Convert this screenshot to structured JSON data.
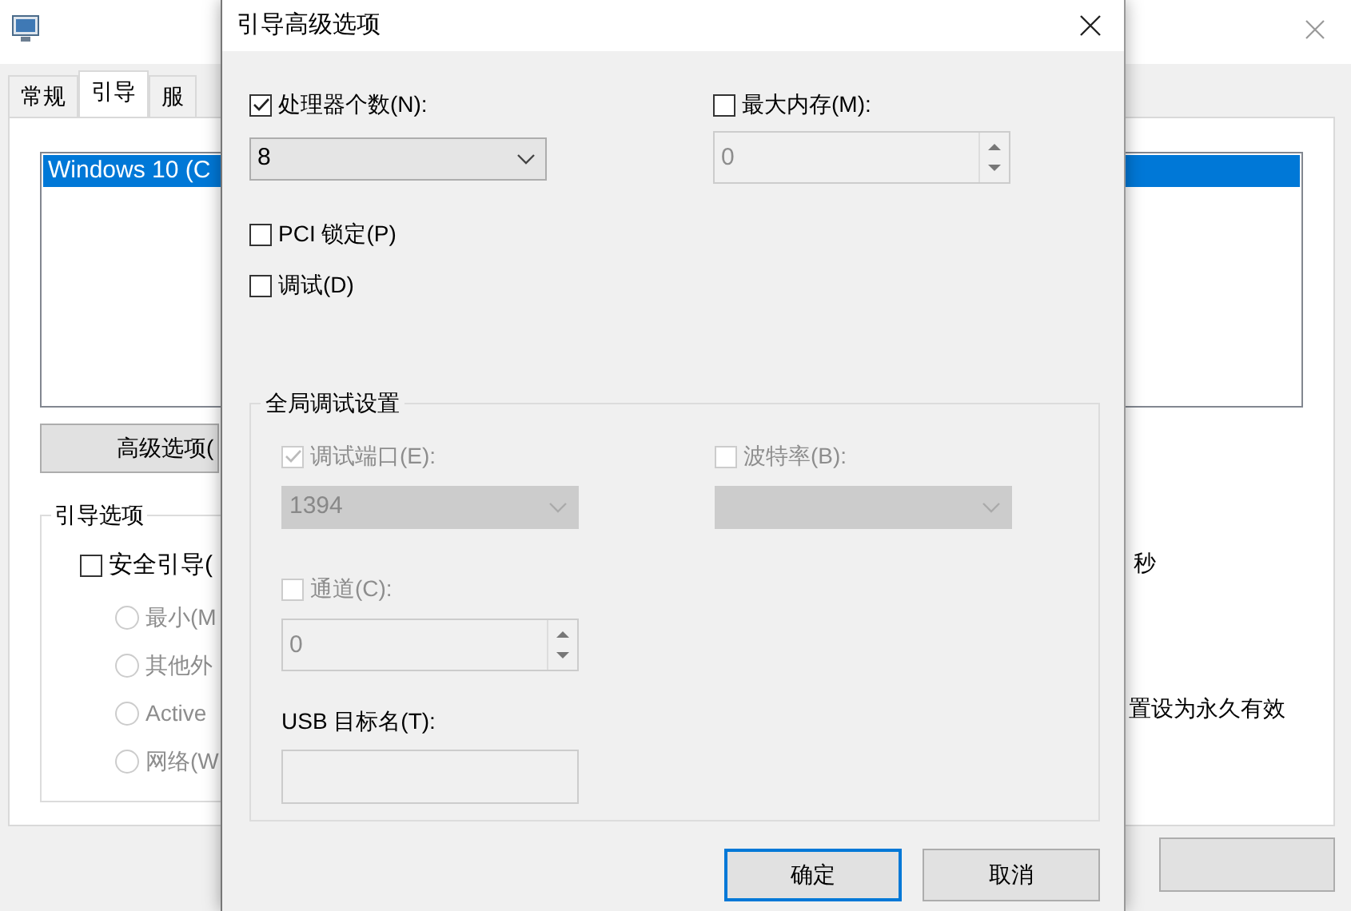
{
  "main_window": {
    "tabs": [
      {
        "label": "常规",
        "selected": false
      },
      {
        "label": "引导",
        "selected": true
      },
      {
        "label": "服",
        "selected": false
      }
    ],
    "boot_list": [
      {
        "label": "Windows 10 (C",
        "selected": true
      }
    ],
    "advanced_button": "高级选项(",
    "boot_options": {
      "title": "引导选项",
      "safe_boot": {
        "label": "安全引导(",
        "checked": false
      },
      "radios": [
        {
          "label": "最小(M",
          "selected": false,
          "disabled": true
        },
        {
          "label": "其他外",
          "selected": false,
          "disabled": true
        },
        {
          "label": "Active",
          "selected": false,
          "disabled": true
        },
        {
          "label": "网络(W",
          "selected": false,
          "disabled": true
        }
      ]
    },
    "timeout_unit": "秒",
    "permanent_label": "置设为永久有效"
  },
  "dialog": {
    "title": "引导高级选项",
    "processors": {
      "label": "处理器个数(N):",
      "checked": true,
      "value": "8",
      "disabled": false
    },
    "max_memory": {
      "label": "最大内存(M):",
      "checked": false,
      "value": "0",
      "disabled": true
    },
    "pci_lock": {
      "label": "PCI 锁定(P)",
      "checked": false
    },
    "debug": {
      "label": "调试(D)",
      "checked": false
    },
    "debug_settings": {
      "title": "全局调试设置",
      "debug_port": {
        "label": "调试端口(E):",
        "checked": true,
        "disabled": true,
        "value": "1394"
      },
      "baud_rate": {
        "label": "波特率(B):",
        "checked": false,
        "disabled": true
      },
      "channel": {
        "label": "通道(C):",
        "checked": false,
        "disabled": true,
        "value": "0"
      },
      "usb_target": {
        "label": "USB 目标名(T):",
        "disabled": true
      }
    },
    "buttons": [
      {
        "label": "确定",
        "default": true
      },
      {
        "label": "取消",
        "default": false
      }
    ]
  }
}
